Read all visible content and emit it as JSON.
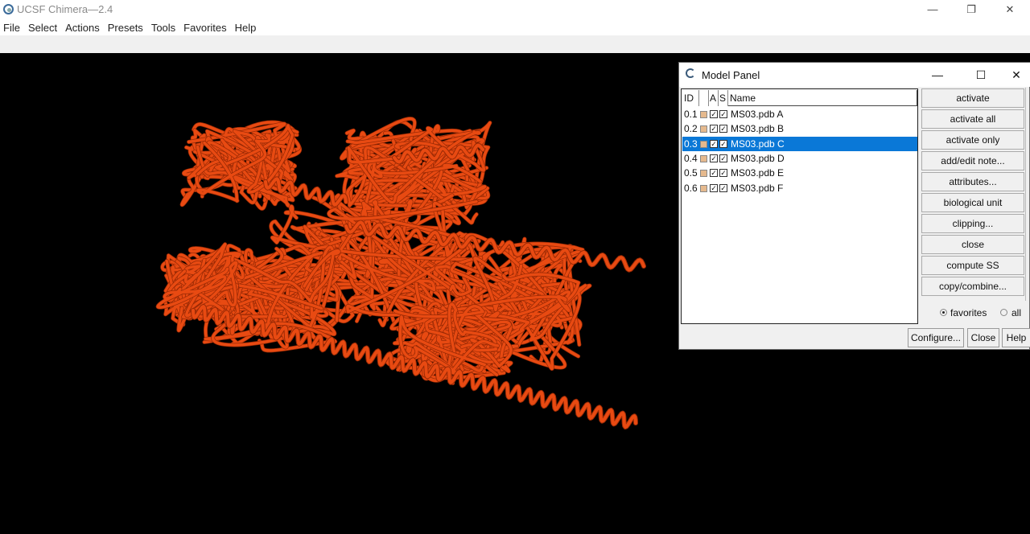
{
  "window": {
    "title": "UCSF Chimera—2.4"
  },
  "menu": [
    "File",
    "Select",
    "Actions",
    "Presets",
    "Tools",
    "Favorites",
    "Help"
  ],
  "colors": {
    "molecule": "#e84a12",
    "selection": "#0a78d7",
    "viewport_bg": "#000000"
  },
  "model_panel": {
    "title": "Model Panel",
    "columns": {
      "id": "ID",
      "a": "A",
      "s": "S",
      "name": "Name"
    },
    "models": [
      {
        "id": "0.1",
        "name": "MS03.pdb A",
        "active": true,
        "shown": true,
        "selected": false
      },
      {
        "id": "0.2",
        "name": "MS03.pdb B",
        "active": true,
        "shown": true,
        "selected": false
      },
      {
        "id": "0.3",
        "name": "MS03.pdb C",
        "active": true,
        "shown": true,
        "selected": true
      },
      {
        "id": "0.4",
        "name": "MS03.pdb D",
        "active": true,
        "shown": true,
        "selected": false
      },
      {
        "id": "0.5",
        "name": "MS03.pdb E",
        "active": true,
        "shown": true,
        "selected": false
      },
      {
        "id": "0.6",
        "name": "MS03.pdb F",
        "active": true,
        "shown": true,
        "selected": false
      }
    ],
    "actions": [
      "activate",
      "activate all",
      "activate only",
      "add/edit note...",
      "attributes...",
      "biological unit",
      "clipping...",
      "close",
      "compute SS",
      "copy/combine..."
    ],
    "filter": {
      "favorites": "favorites",
      "all": "all",
      "selected": "favorites"
    },
    "buttons": {
      "configure": "Configure...",
      "close": "Close",
      "help": "Help"
    }
  }
}
